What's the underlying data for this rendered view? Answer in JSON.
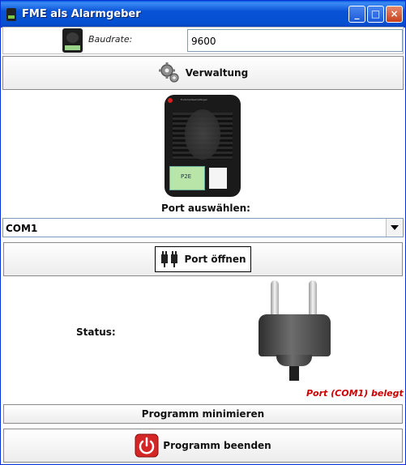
{
  "window": {
    "title": "FME als Alarmgeber",
    "controls": [
      "_",
      "□",
      "×"
    ]
  },
  "baudrate": {
    "label": "Baudrate:",
    "value": "9600"
  },
  "buttons": {
    "verwaltung": "Verwaltung",
    "port_open": "Port öffnen",
    "minimize": "Programm minimieren",
    "quit": "Programm beenden"
  },
  "device": {
    "screen_text": "P2E",
    "brand": "Funkmeldeempfänger"
  },
  "port": {
    "label": "Port auswählen:",
    "selected": "COM1"
  },
  "status": {
    "label": "Status:",
    "message": "Port (COM1) belegt",
    "message_color": "#cc0000"
  }
}
